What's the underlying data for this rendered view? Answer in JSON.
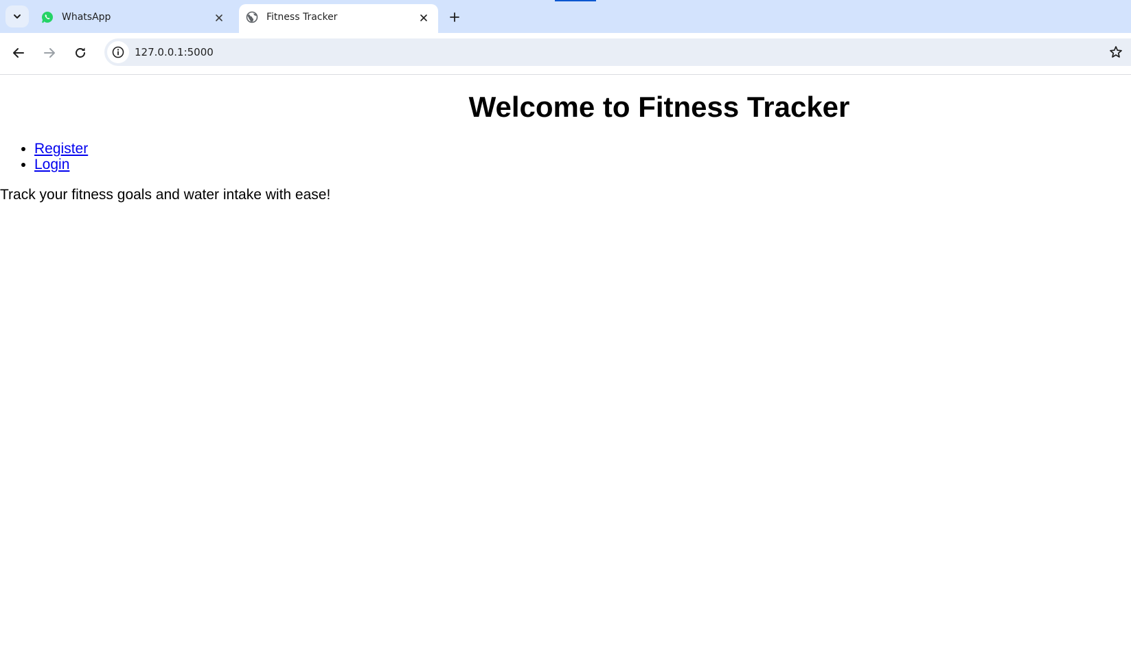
{
  "tabs": [
    {
      "title": "WhatsApp",
      "icon": "whatsapp-icon",
      "active": false
    },
    {
      "title": "Fitness Tracker",
      "icon": "globe-icon",
      "active": true
    }
  ],
  "address_bar": {
    "url": "127.0.0.1:5000"
  },
  "page": {
    "heading": "Welcome to Fitness Tracker",
    "links": [
      {
        "label": "Register"
      },
      {
        "label": "Login"
      }
    ],
    "tagline": "Track your fitness goals and water intake with ease!"
  },
  "colors": {
    "tabstrip_bg": "#d3e3fd",
    "omnibox_bg": "#e9eef6",
    "link": "#0000ee",
    "whatsapp_green": "#25d366"
  }
}
